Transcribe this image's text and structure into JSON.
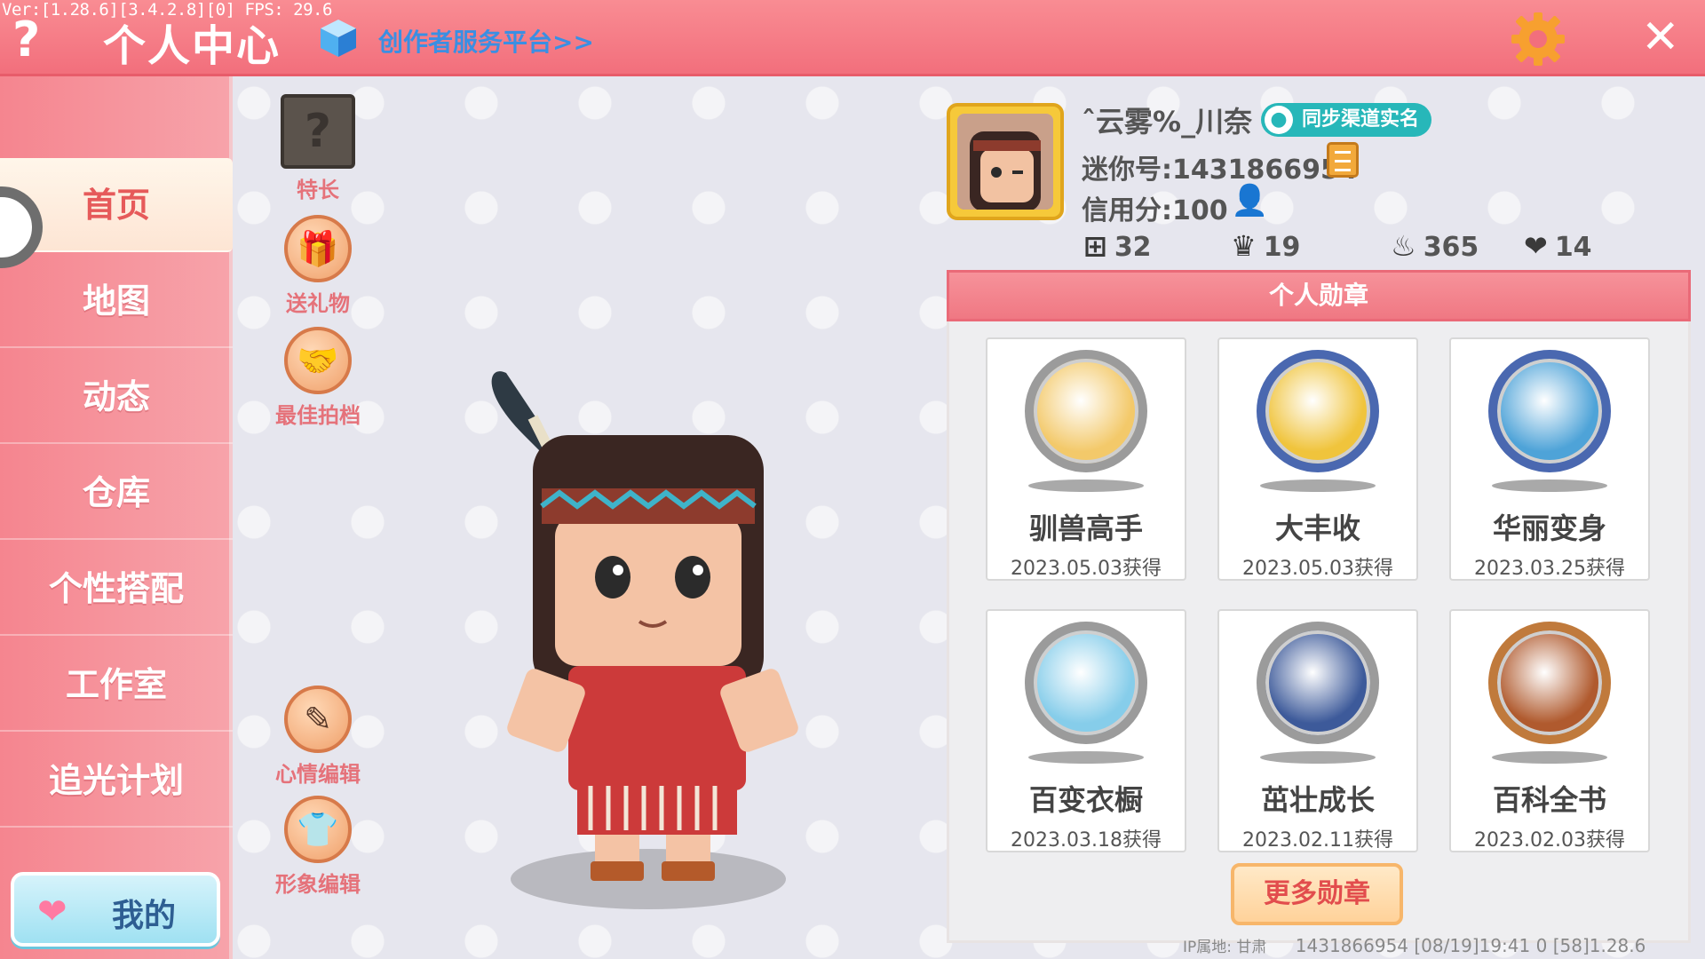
{
  "debug": {
    "version": "Ver:[1.28.6][3.4.2.8][0] FPS: 29.6"
  },
  "header": {
    "help": "?",
    "title": "个人中心",
    "creator_link": "创作者服务平台>>",
    "close": "✕"
  },
  "sidebar": {
    "items": [
      {
        "label": "首页",
        "active": true
      },
      {
        "label": "地图"
      },
      {
        "label": "动态"
      },
      {
        "label": "仓库"
      },
      {
        "label": "个性搭配"
      },
      {
        "label": "工作室"
      },
      {
        "label": "追光计划"
      }
    ],
    "mine_label": "我的"
  },
  "tools": {
    "specialty": "特长",
    "specialty_glyph": "?",
    "gift": "送礼物",
    "partner": "最佳拍档",
    "mood": "心情编辑",
    "avatar_edit": "形象编辑"
  },
  "profile": {
    "username": "ˆ云雾%_川奈",
    "verify_label": "同步渠道实名",
    "mini_id": "迷你号:1431866954",
    "credit": "信用分:100",
    "stats": {
      "plus": "32",
      "trophy": "19",
      "fire": "365",
      "heart": "14"
    }
  },
  "medals": {
    "title": "个人勋章",
    "items": [
      {
        "name": "驯兽高手",
        "date": "2023.05.03获得",
        "color": "#f3c96a",
        "rim": "#9b9b9b"
      },
      {
        "name": "大丰收",
        "date": "2023.05.03获得",
        "color": "#f0c43c",
        "rim": "#4a68b0"
      },
      {
        "name": "华丽变身",
        "date": "2023.03.25获得",
        "color": "#4ea3d8",
        "rim": "#4a68b0"
      },
      {
        "name": "百变衣橱",
        "date": "2023.03.18获得",
        "color": "#86cdea",
        "rim": "#9b9b9b"
      },
      {
        "name": "茁壮成长",
        "date": "2023.02.11获得",
        "color": "#3d5a9a",
        "rim": "#9b9b9b"
      },
      {
        "name": "百科全书",
        "date": "2023.02.03获得",
        "color": "#b05a2e",
        "rim": "#c07a3c"
      }
    ],
    "more_label": "更多勋章"
  },
  "footer": {
    "ip": "IP属地: 甘肃",
    "info": "1431866954   [08/19]19:41 0   [58]1.28.6"
  }
}
